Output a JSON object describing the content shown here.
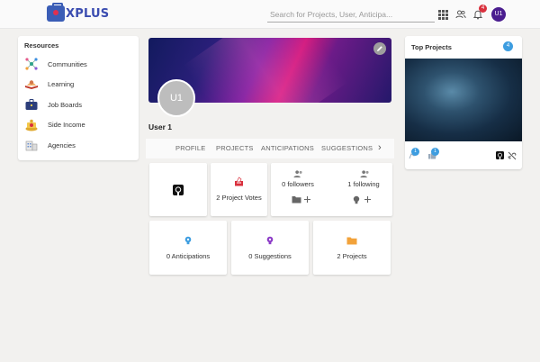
{
  "header": {
    "logo_text": "XPLUS",
    "search_placeholder": "Search for Projects, User, Anticipa...",
    "notification_count": "4",
    "user_initials": "U1"
  },
  "resources": {
    "title": "Resources",
    "items": [
      {
        "label": "Communities",
        "icon": "network-icon"
      },
      {
        "label": "Learning",
        "icon": "learning-icon"
      },
      {
        "label": "Job Boards",
        "icon": "briefcase-icon"
      },
      {
        "label": "Side Income",
        "icon": "coins-icon"
      },
      {
        "label": "Agencies",
        "icon": "agency-icon"
      }
    ]
  },
  "profile": {
    "avatar_initials": "U1",
    "name": "User 1"
  },
  "tabs": [
    "PROFILE",
    "PROJECTS",
    "ANTICIPATIONS",
    "SUGGESTIONS"
  ],
  "stats": {
    "project_votes": "2 Project Votes",
    "followers": "0 followers",
    "following": "1 following",
    "anticipations": "0 Anticipations",
    "suggestions": "0 Suggestions",
    "projects": "2 Projects"
  },
  "top_projects": {
    "title": "Top Projects",
    "count": "4",
    "badge_a": "1",
    "badge_b": "1"
  },
  "colors": {
    "brand": "#3a4cb0",
    "accent_blue": "#3d9de0",
    "notification_red": "#d9303d",
    "avatar_purple": "#4a1d8f"
  }
}
